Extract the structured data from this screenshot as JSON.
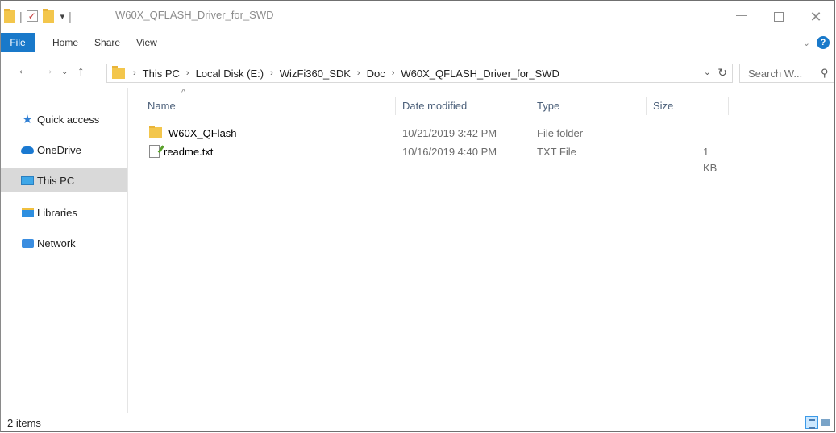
{
  "window": {
    "title": "W60X_QFLASH_Driver_for_SWD",
    "minimize_glyph": "—",
    "close_glyph": "✕"
  },
  "quick_access_toolbar": {
    "separator": "|",
    "check_glyph": "✓",
    "customize_glyph": "▾"
  },
  "ribbon": {
    "tabs": [
      "File",
      "Home",
      "Share",
      "View"
    ],
    "expand_glyph": "⌄",
    "help_glyph": "?"
  },
  "nav_buttons": {
    "back": "←",
    "forward": "→",
    "recent": "⌄",
    "up": "↑"
  },
  "address_bar": {
    "breadcrumbs": [
      "This PC",
      "Local Disk (E:)",
      "WizFi360_SDK",
      "Doc",
      "W60X_QFLASH_Driver_for_SWD"
    ],
    "separator_glyph": "›",
    "dropdown_glyph": "⌄",
    "refresh_glyph": "↻"
  },
  "search": {
    "placeholder": "Search W...",
    "icon_glyph": "⚲"
  },
  "nav_pane": {
    "items": [
      {
        "label": "Quick access",
        "icon": "star-icon"
      },
      {
        "label": "OneDrive",
        "icon": "cloud-icon"
      },
      {
        "label": "This PC",
        "icon": "computer-icon",
        "selected": true
      },
      {
        "label": "Libraries",
        "icon": "library-icon"
      },
      {
        "label": "Network",
        "icon": "network-icon"
      }
    ],
    "star_glyph": "★"
  },
  "file_list": {
    "sort_glyph": "^",
    "columns": [
      "Name",
      "Date modified",
      "Type",
      "Size"
    ],
    "rows": [
      {
        "name": "W60X_QFlash",
        "date": "10/21/2019 3:42 PM",
        "type": "File folder",
        "size": "",
        "icon": "folder-icon"
      },
      {
        "name": "readme.txt",
        "date": "10/16/2019 4:40 PM",
        "type": "TXT File",
        "size": "1 KB",
        "icon": "text-file-icon"
      }
    ]
  },
  "status_bar": {
    "item_count": "2 items"
  }
}
